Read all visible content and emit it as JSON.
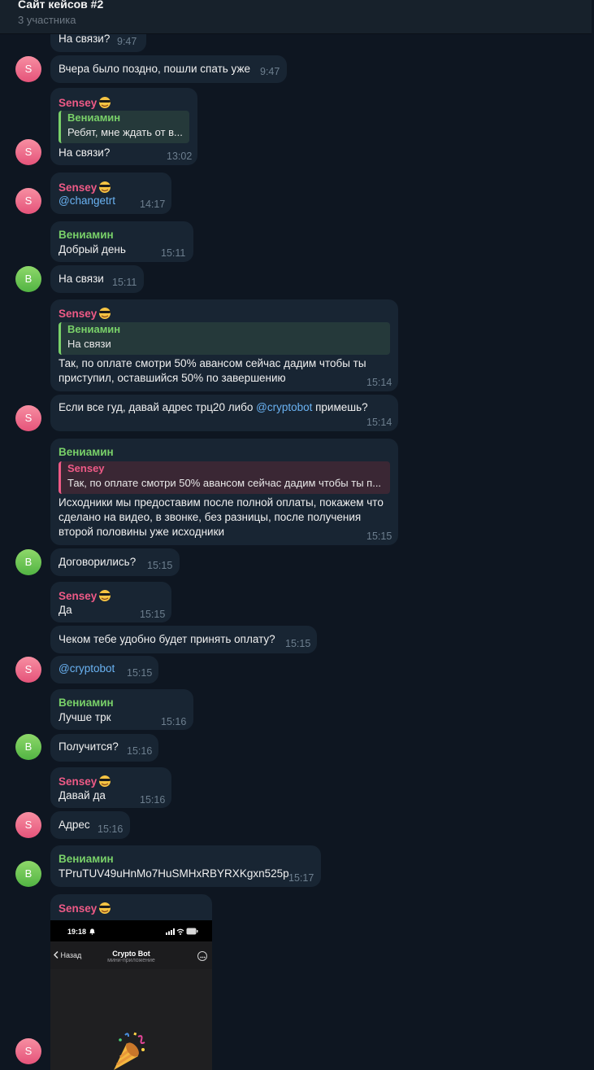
{
  "header": {
    "title": "Сайт кейсов #2",
    "subtitle": "3 участника"
  },
  "avatars": {
    "sensey": "S",
    "veniamin": "В"
  },
  "names": {
    "sensey": "Sensey",
    "veniamin": "Вениамин"
  },
  "messages": [
    {
      "text": "На связи?",
      "time": "9:47"
    },
    {
      "text": "Вчера было поздно, пошли спать уже",
      "time": "9:47"
    },
    {
      "sender": "Sensey",
      "reply_name": "Вениамин",
      "reply_text": "Ребят, мне ждать от в...",
      "text": "На связи?",
      "time": "13:02"
    },
    {
      "sender": "Sensey",
      "text": "@changetrt",
      "time": "14:17"
    },
    {
      "sender": "Вениамин",
      "text": "Добрый день",
      "time": "15:11"
    },
    {
      "text": "На связи",
      "time": "15:11"
    },
    {
      "sender": "Sensey",
      "reply_name": "Вениамин",
      "reply_text": "На связи",
      "text_line1": "Так, по оплате смотри 50% авансом сейчас дадим чтобы ты",
      "text_line2": "приступил, оставшийся 50% по завершению",
      "time": "15:14"
    },
    {
      "text_before": "Если все гуд, давай адрес трц20 либо ",
      "link": "@cryptobot",
      "text_after": " примешь?",
      "time": "15:14"
    },
    {
      "sender": "Вениамин",
      "reply_name": "Sensey",
      "reply_text": "Так, по оплате смотри 50% авансом сейчас дадим чтобы ты п...",
      "text_line1": "Исходники мы предоставим после полной оплаты, покажем что",
      "text_line2": "сделано на видео, в звонке, без разницы, после получения",
      "text_line3": "второй половины уже исходники",
      "time": "15:15"
    },
    {
      "text": "Договорились?",
      "time": "15:15"
    },
    {
      "sender": "Sensey",
      "text": "Да",
      "time": "15:15"
    },
    {
      "text": "Чеком тебе удобно будет принять оплату?",
      "time": "15:15"
    },
    {
      "text": "@cryptobot",
      "time": "15:15"
    },
    {
      "sender": "Вениамин",
      "text": "Лучше трк",
      "time": "15:16"
    },
    {
      "text": "Получится?",
      "time": "15:16"
    },
    {
      "sender": "Sensey",
      "text": "Давай да",
      "time": "15:16"
    },
    {
      "text": "Адрес",
      "time": "15:16"
    },
    {
      "sender": "Вениамин",
      "text": "TPruTUV49uHnMo7HuSMHxRBYRXKgxn525p",
      "time": "15:17"
    },
    {
      "sender": "Sensey"
    }
  ],
  "photo": {
    "clock": "19:18",
    "back": "Назад",
    "title": "Crypto Bot",
    "subtitle": "мини-приложение"
  },
  "colors": {
    "background": "#0e1621",
    "bubble": "#182533",
    "sensey": "#ee5a86",
    "veniamin": "#79d169",
    "link": "#6ab2f2"
  },
  "icons": [
    "sunglasses-emoji-icon",
    "chevron-left-icon",
    "more-icon",
    "party-popper-icon",
    "bell-icon",
    "signal-icon",
    "wifi-icon",
    "battery-icon"
  ]
}
